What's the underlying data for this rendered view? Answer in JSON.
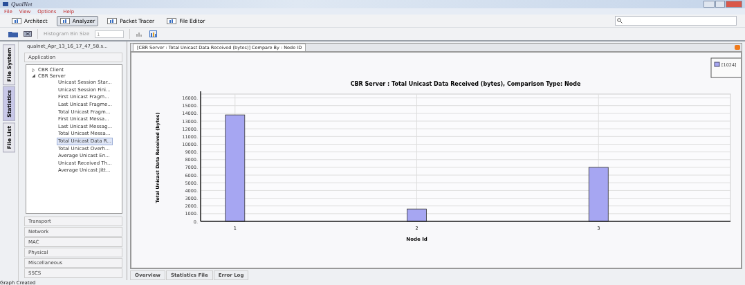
{
  "window": {
    "title": "QualNet"
  },
  "menu": [
    "File",
    "View",
    "Options",
    "Help"
  ],
  "mode_tabs": [
    {
      "label": "Architect",
      "selected": false
    },
    {
      "label": "Analyzer",
      "selected": true
    },
    {
      "label": "Packet Tracer",
      "selected": false
    },
    {
      "label": "File Editor",
      "selected": false
    }
  ],
  "toolbar": {
    "histogram_label": "Histogram Bin Size",
    "histogram_value": "1"
  },
  "side_tabs": [
    {
      "label": "File System",
      "selected": false
    },
    {
      "label": "Statistics",
      "selected": true
    },
    {
      "label": "File List",
      "selected": false
    }
  ],
  "statistics_panel": {
    "file": "qualnet_Apr_13_16_17_47_58.s...",
    "categories_top": [
      "Application"
    ],
    "tree": [
      {
        "label": "CBR Client",
        "expanded": false
      },
      {
        "label": "CBR Server",
        "expanded": true,
        "children": [
          {
            "label": "Unicast Session Star...",
            "selected": false
          },
          {
            "label": "Unicast Session Fini...",
            "selected": false
          },
          {
            "label": "First Unicast Fragm...",
            "selected": false
          },
          {
            "label": "Last Unicast Fragme...",
            "selected": false
          },
          {
            "label": "Total Unicast Fragm...",
            "selected": false
          },
          {
            "label": "First Unicast Messa...",
            "selected": false
          },
          {
            "label": "Last Unicast Messag...",
            "selected": false
          },
          {
            "label": "Total Unicast Messa...",
            "selected": false
          },
          {
            "label": "Total Unicast Data R...",
            "selected": true
          },
          {
            "label": "Total Unicast Overh...",
            "selected": false
          },
          {
            "label": "Average Unicast En...",
            "selected": false
          },
          {
            "label": "Unicast Received Th...",
            "selected": false
          },
          {
            "label": "Average Unicast Jitt...",
            "selected": false
          }
        ]
      }
    ],
    "categories_bottom": [
      "Transport",
      "Network",
      "MAC",
      "Physical",
      "Miscellaneous",
      "SSCS"
    ]
  },
  "document_tab": {
    "label": "[CBR Server :  Total Unicast Data Received (bytes)] Compare By : Node ID"
  },
  "chart_data": {
    "type": "bar",
    "title": "CBR Server :  Total Unicast Data Received (bytes), Comparison Type: Node",
    "xlabel": "Node Id",
    "ylabel": "Total Unicast Data Received (bytes)",
    "categories": [
      "1",
      "2",
      "3"
    ],
    "series": [
      {
        "name": "[1024]",
        "color": "#a6a6f2",
        "values": [
          13800,
          1600,
          7000
        ]
      }
    ],
    "ylim": [
      0,
      16500
    ],
    "grid": true,
    "yticks": [
      {
        "value": 0,
        "label": "0."
      },
      {
        "value": 1000,
        "label": "1000."
      },
      {
        "value": 2000,
        "label": "2000."
      },
      {
        "value": 3000,
        "label": "3000."
      },
      {
        "value": 4000,
        "label": "4000."
      },
      {
        "value": 5000,
        "label": "5000."
      },
      {
        "value": 6000,
        "label": "6000."
      },
      {
        "value": 7000,
        "label": "7000."
      },
      {
        "value": 8000,
        "label": "8000."
      },
      {
        "value": 9000,
        "label": "9000."
      },
      {
        "value": 10000,
        "label": "10000."
      },
      {
        "value": 11000,
        "label": "11000."
      },
      {
        "value": 12000,
        "label": "12000."
      },
      {
        "value": 13000,
        "label": "13000."
      },
      {
        "value": 14000,
        "label": "14000."
      },
      {
        "value": 15000,
        "label": "15000."
      },
      {
        "value": 16000,
        "label": "16000."
      }
    ]
  },
  "bottom_tabs": [
    "Overview",
    "Statistics File",
    "Error Log"
  ],
  "status_bar": "Graph Created"
}
